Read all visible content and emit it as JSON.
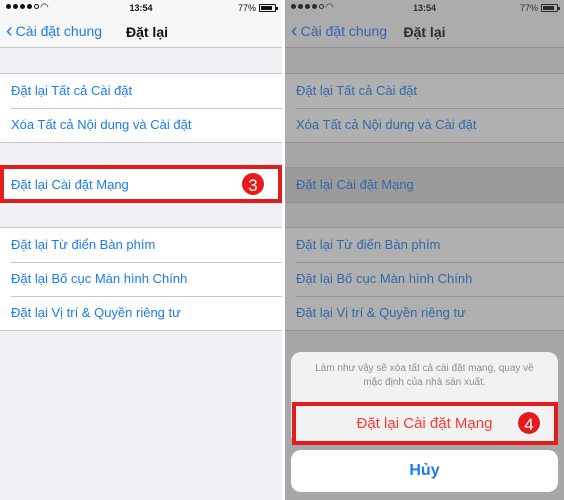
{
  "left_screen": {
    "status": {
      "time": "13:54",
      "battery": "77%"
    },
    "nav": {
      "back_label": "Cài đặt chung",
      "title": "Đặt lại"
    },
    "groups": [
      [
        "Đặt lại Tất cả Cài đặt",
        "Xóa Tất cả Nội dung và Cài đặt"
      ],
      [
        "Đặt lại Cài đặt Mạng"
      ],
      [
        "Đặt lại Từ điển Bàn phím",
        "Đặt lại Bố cục Màn hình Chính",
        "Đặt lại Vị trí & Quyền riêng tư"
      ]
    ],
    "step_badge": "3"
  },
  "right_screen": {
    "status": {
      "time": "13:54",
      "battery": "77%"
    },
    "nav": {
      "back_label": "Cài đặt chung",
      "title": "Đặt lại"
    },
    "groups": [
      [
        "Đặt lại Tất cả Cài đặt",
        "Xóa Tất cả Nội dung và Cài đặt"
      ],
      [
        "Đặt lại Cài đặt Mạng"
      ],
      [
        "Đặt lại Từ điển Bàn phím",
        "Đặt lại Bố cục Màn hình Chính",
        "Đặt lại Vị trí & Quyền riêng tư"
      ]
    ],
    "sheet": {
      "message": "Làm như vậy sẽ xóa tất cả cài đặt mạng, quay về mặc định của nhà sản xuất.",
      "confirm_label": "Đặt lại Cài đặt Mạng",
      "cancel_label": "Hủy"
    },
    "step_badge": "4"
  },
  "colors": {
    "ios_blue": "#1a7cf0",
    "destructive_red": "#ff3b30",
    "annotation_red": "#e51c1c"
  },
  "icons": [
    "signal-dots-icon",
    "wifi-icon",
    "battery-icon",
    "chevron-left-icon"
  ]
}
